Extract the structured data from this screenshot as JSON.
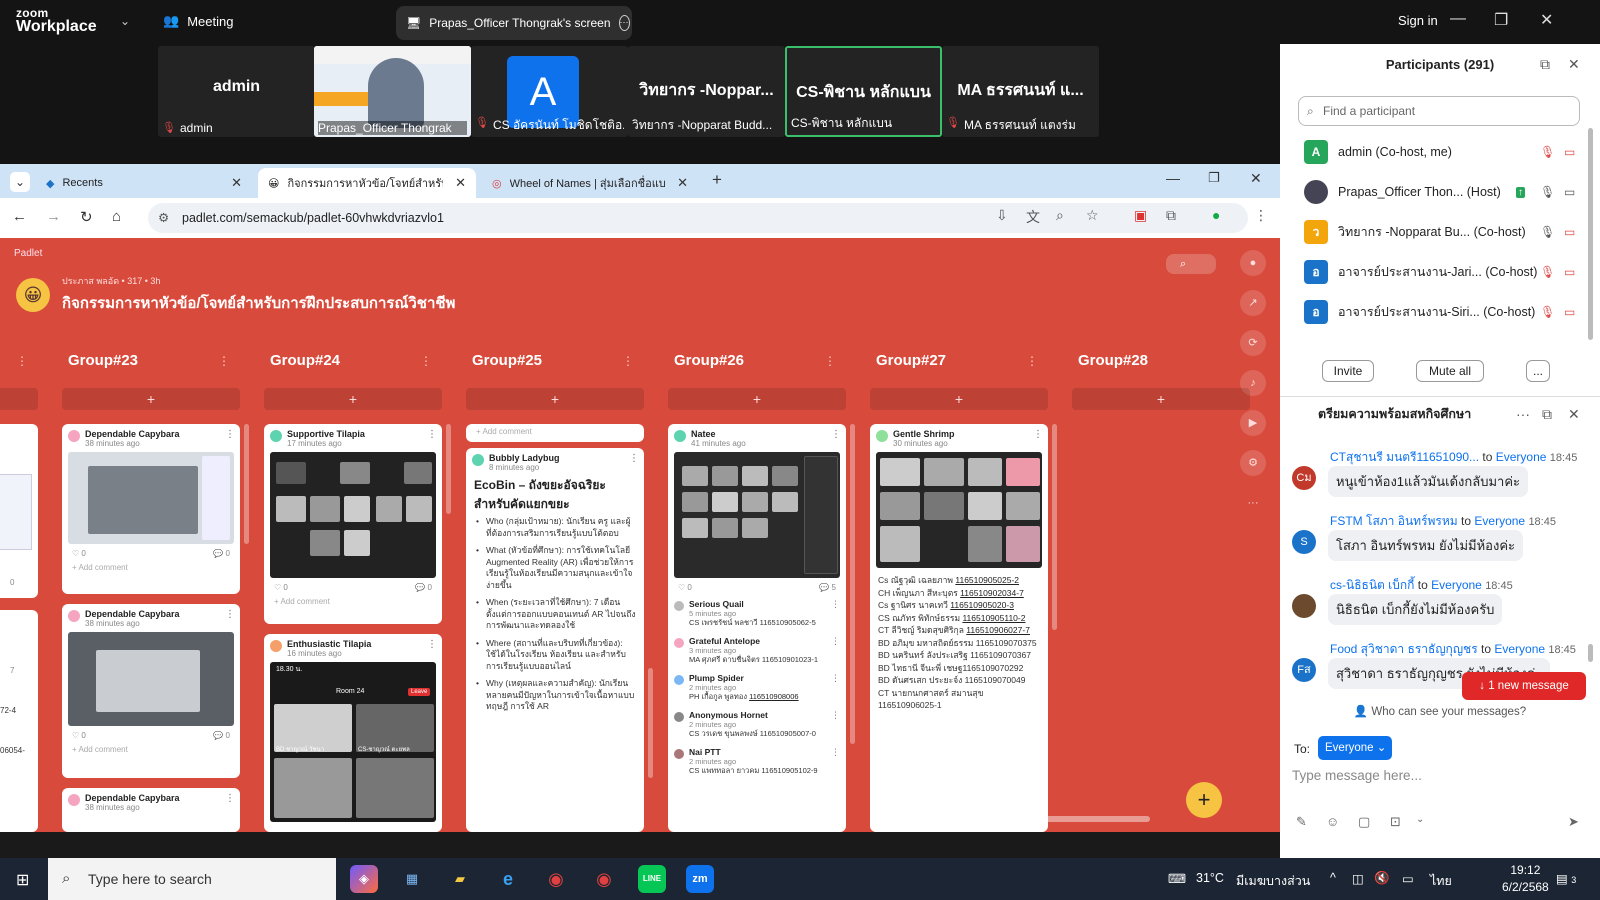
{
  "zoom": {
    "logo_top": "zoom",
    "logo_bottom": "Workplace",
    "meeting_label": "Meeting",
    "share_title": "Prapas_Officer Thongrak's screen",
    "sign_in": "Sign in"
  },
  "strip": [
    {
      "name": "admin",
      "label": "admin",
      "muted": true
    },
    {
      "name": "",
      "label": "Prapas_Officer Thongrak",
      "muted": false,
      "video": true
    },
    {
      "name": "A",
      "label": "CS อัครนันท์ โมชิดโชติอ...",
      "muted": true,
      "avatar": true
    },
    {
      "name": "วิทยากร -Noppar...",
      "label": "วิทยากร -Nopparat Budd...",
      "muted": false
    },
    {
      "name": "CS-พิชาน หลักแบน",
      "label": "CS-พิชาน หลักแบน",
      "muted": false,
      "active": true
    },
    {
      "name": "MA ธรรศนนท์ แ...",
      "label": "MA ธรรศนนท์ แตงร่ม",
      "muted": true
    }
  ],
  "browser": {
    "tabs": [
      {
        "label": "Recents"
      },
      {
        "label": "กิจกรรมการหาหัวข้อ/โจทย์สำหรับก"
      },
      {
        "label": "Wheel of Names | สุ่มเลือกชื่อแบบ"
      }
    ],
    "url": "padlet.com/semackub/padlet-60vhwkdvriazvlo1"
  },
  "padlet": {
    "brand": "Padlet",
    "meta": "ประภาส พลอัด • 317 • 3h",
    "title": "กิจกรรมการหาหัวข้อ/โจทย์สำหรับการฝึกประสบการณ์วิชาชีพ",
    "add": "+",
    "columns": [
      {
        "header": "Group#23"
      },
      {
        "header": "Group#24"
      },
      {
        "header": "Group#25"
      },
      {
        "header": "Group#26"
      },
      {
        "header": "Group#27"
      },
      {
        "header": "Group#28"
      }
    ],
    "add_comment": "Add comment",
    "partial_col": {
      "c1": "0",
      "c2": "7",
      "t1": "72-4",
      "t2": "06054-"
    },
    "g23": [
      {
        "author": "Dependable Capybara",
        "time": "38 minutes ago",
        "likes": "0",
        "comments": "0"
      },
      {
        "author": "Dependable Capybara",
        "time": "38 minutes ago",
        "likes": "0",
        "comments": "0"
      },
      {
        "author": "Dependable Capybara",
        "time": "38 minutes ago"
      }
    ],
    "g24": [
      {
        "author": "Supportive Tilapia",
        "time": "17 minutes ago",
        "likes": "0",
        "comments": "0"
      },
      {
        "author": "Enthusiastic Tilapia",
        "time": "16 minutes ago",
        "phone_time": "18.30 น.",
        "room": "Room 24",
        "leave": "Leave",
        "n1": "BD ชาญวณ์ วัชนา",
        "n2": "CS-ชาญวณ์ ตะยพล"
      }
    ],
    "g25": {
      "top_comment": "Add comment",
      "author": "Bubbly Ladybug",
      "time": "8 minutes ago",
      "title1": "EcoBin – ถังขยะอัจฉริยะ",
      "title2": "สำหรับคัดแยกขยะ",
      "bullets": [
        "Who (กลุ่มเป้าหมาย): นักเรียน ครู และผู้ที่ต้องการเสริมการเรียนรู้แบบโต้ตอบ",
        "What (หัวข้อที่ศึกษา): การใช้เทคโนโลยี Augmented Reality (AR) เพื่อช่วยให้การเรียนรู้ในห้องเรียนมีความสนุกและเข้าใจง่ายขึ้น",
        "When (ระยะเวลาที่ใช้ศึกษา): 7 เดือน ตั้งแต่การออกแบบคอนเทนต์ AR ไปจนถึงการพัฒนาและทดลองใช้",
        "Where (สถานที่และบริบทที่เกี่ยวข้อง): ใช้ได้ในโรงเรียน ห้องเรียน และสำหรับการเรียนรู้แบบออนไลน์",
        "Why (เหตุผลและความสำคัญ): นักเรียนหลายคนมีปัญหาในการเข้าใจเนื้อหาแบบทฤษฎี การใช้ AR"
      ]
    },
    "g26": {
      "author": "Natee",
      "time": "41 minutes ago",
      "likes": "0",
      "comments": "5",
      "subs": [
        {
          "name": "Serious Quail",
          "time": "5 minutes ago",
          "text": "CS เพรชรัชน์ พลชาวี 116510905062-5"
        },
        {
          "name": "Grateful Antelope",
          "time": "3 minutes ago",
          "text": "MA ศุภศรี ดาบชื่นจิตร 116510901023-1"
        },
        {
          "name": "Plump Spider",
          "time": "2 minutes ago",
          "text": "PH เกื้อกูล พูลทอง",
          "link": "116510908006"
        },
        {
          "name": "Anonymous Hornet",
          "time": "2 minutes ago",
          "text": "CS วรเดช ขุนพลพงษ์ 116510905007-0"
        },
        {
          "name": "Nai PTT",
          "time": "2 minutes ago",
          "text": "CS แพททอลา ยาวคม 116510905102-9"
        }
      ]
    },
    "g27": {
      "author": "Gentle Shrimp",
      "time": "30 minutes ago",
      "lines": [
        {
          "t": "Cs ณัฐวุฒิ เฉลยภาพ ",
          "l": "116510905025-2"
        },
        {
          "t": "CH เพ็ญนภา สีหะบุตร ",
          "l": "116510902034-7"
        },
        {
          "t": "Cs ฐานิศร นาคเทวี ",
          "l": "116510905020-3"
        },
        {
          "t": "CS ณภัทร พิทักษ์ธรรม ",
          "l": "116510905110-2"
        },
        {
          "t": "CT ลีวิชญ์ ริมดสุขศิริกุล ",
          "l": "116510906027-7"
        },
        {
          "t": "BD อภิมุข มหาสถิตย์ธรรม 1165109070375",
          "l": ""
        },
        {
          "t": "BD นครินทร์ ลังประเสริฐ 1165109070367",
          "l": ""
        },
        {
          "t": "BD ไทธานี จีนะพี่ เชษฐ1165109070292",
          "l": ""
        },
        {
          "t": "BD ดันศรเสก ประยะจ์ง 1165109070049",
          "l": ""
        },
        {
          "t": "CT นายกนกศาสตร์ สมานสุข 116510906025-1",
          "l": ""
        }
      ]
    }
  },
  "panel": {
    "title": "Participants (291)",
    "find_placeholder": "Find a participant",
    "participants": [
      {
        "initial": "A",
        "name": "admin (Co-host, me)",
        "color": "#26a65b"
      },
      {
        "initial": "",
        "name": "Prapas_Officer Thon... (Host)",
        "color": "#445"
      },
      {
        "initial": "ว",
        "name": "วิทยากร -Nopparat Bu... (Co-host)",
        "color": "#f2a60c"
      },
      {
        "initial": "อ",
        "name": "อาจารย์ประสานงาน-Jari... (Co-host)",
        "color": "#1a73c8"
      },
      {
        "initial": "อ",
        "name": "อาจารย์ประสานงาน-Siri... (Co-host)",
        "color": "#1a73c8"
      }
    ],
    "invite": "Invite",
    "mute_all": "Mute all",
    "more": "...",
    "chat_title": "ตรียมความพร้อมสหกิจศึกษา",
    "messages": [
      {
        "from": "CTสุชานรี มนตรี11651090...",
        "to": "to",
        "everyone": "Everyone",
        "time": "18:45",
        "text": "หนูเข้าห้อง1แล้วมันเด้งกลับมาค่ะ",
        "initials": "Cม",
        "color": "#c0392b"
      },
      {
        "from": "FSTM โสภา อินทร์พรหม",
        "to": "to",
        "everyone": "Everyone",
        "time": "18:45",
        "text": "โสภา อินทร์พรหม ยังไม่มีห้องค่ะ",
        "initials": "S",
        "color": "#1a73c8"
      },
      {
        "from": "cs-นิธิธนิต เบ็กกี้",
        "to": "to",
        "everyone": "Everyone",
        "time": "18:45",
        "text": "นิธิธนิต เบ็กกี้ยังไม่มีห้องครับ",
        "initials": "",
        "color": "#6b4a2e"
      },
      {
        "from": "Food สุวิชาดา ธราธัญกุญชร",
        "to": "to",
        "everyone": "Everyone",
        "time": "18:45",
        "text": "สุวิชาดา ธราธัญกุญชร ยังไม่มีห้องค่ะ",
        "initials": "Fส",
        "color": "#1a73c8"
      }
    ],
    "new_message": "1 new message",
    "who_can_see": "Who can see your messages?",
    "to_label": "To:",
    "to_value": "Everyone",
    "type_placeholder": "Type message here..."
  },
  "taskbar": {
    "search": "Type here to search",
    "temp": "31°C",
    "weather": "มีเมฆบางส่วน",
    "lang": "ไทย",
    "time": "19:12",
    "date": "6/2/2568",
    "notif": "3"
  }
}
